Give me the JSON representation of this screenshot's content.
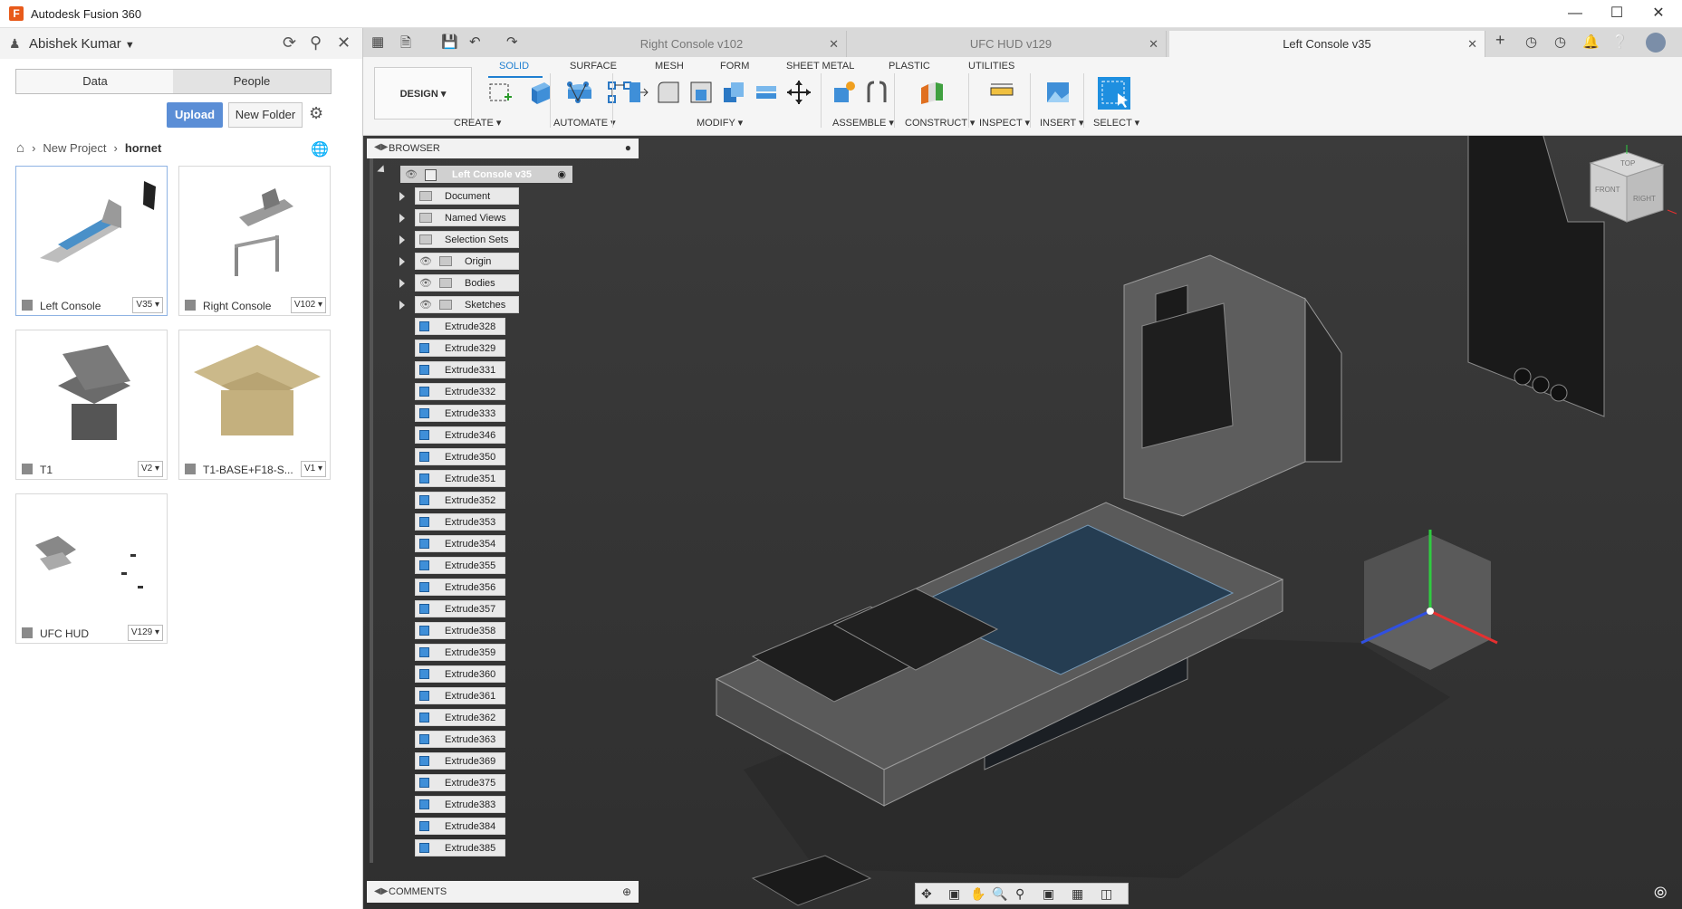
{
  "window": {
    "title": "Autodesk Fusion 360",
    "minimize": "—",
    "maximize": "☐",
    "close": "✕"
  },
  "data_panel": {
    "user": "Abishek Kumar",
    "tabs": [
      "Data",
      "People"
    ],
    "upload_label": "Upload",
    "new_folder_label": "New Folder",
    "breadcrumb": [
      "New Project",
      "hornet"
    ],
    "files": [
      {
        "name": "Left Console",
        "version": "V35 ▾"
      },
      {
        "name": "Right Console",
        "version": "V102 ▾"
      },
      {
        "name": "T1",
        "version": "V2 ▾"
      },
      {
        "name": "T1-BASE+F18-S...",
        "version": "V1 ▾"
      },
      {
        "name": "UFC HUD",
        "version": "V129 ▾"
      }
    ]
  },
  "doc_tabs": [
    {
      "label": "Right Console v102",
      "close": "✕"
    },
    {
      "label": "UFC HUD v129",
      "close": "✕"
    },
    {
      "label": "Left Console v35",
      "close": "✕"
    }
  ],
  "toolbar": {
    "workspace": "DESIGN ▾",
    "tabs": [
      "SOLID",
      "SURFACE",
      "MESH",
      "FORM",
      "SHEET METAL",
      "PLASTIC",
      "UTILITIES"
    ],
    "groups": [
      "CREATE ▾",
      "AUTOMATE ▾",
      "MODIFY ▾",
      "ASSEMBLE ▾",
      "CONSTRUCT ▾",
      "INSPECT ▾",
      "INSERT ▾",
      "SELECT ▾"
    ]
  },
  "browser": {
    "title": "BROWSER",
    "root": "Left Console v35",
    "folders": [
      "Document Settings",
      "Named Views",
      "Selection Sets",
      "Origin",
      "Bodies",
      "Sketches"
    ],
    "features": [
      "Extrude328",
      "Extrude329",
      "Extrude331",
      "Extrude332",
      "Extrude333",
      "Extrude346",
      "Extrude350",
      "Extrude351",
      "Extrude352",
      "Extrude353",
      "Extrude354",
      "Extrude355",
      "Extrude356",
      "Extrude357",
      "Extrude358",
      "Extrude359",
      "Extrude360",
      "Extrude361",
      "Extrude362",
      "Extrude363",
      "Extrude369",
      "Extrude375",
      "Extrude383",
      "Extrude384",
      "Extrude385"
    ]
  },
  "comments": {
    "title": "COMMENTS"
  },
  "viewcube": {
    "top": "TOP",
    "front": "FRONT",
    "right": "RIGHT"
  },
  "colors": {
    "accent": "#1f7fd1",
    "upload": "#5b8ed6",
    "viewport_bg": "#333333",
    "body_blue": "#3f8fd8"
  }
}
